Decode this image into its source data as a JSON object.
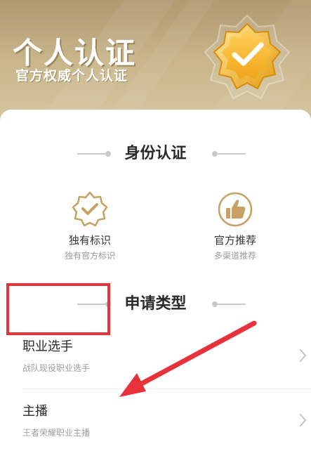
{
  "banner": {
    "title": "个人认证",
    "subtitle": "官方权威个人认证",
    "badge_icon": "verified-badge-icon",
    "colors": {
      "gold": "#f5b72c",
      "gold_dark": "#e39a12",
      "background": "#c8b58b"
    }
  },
  "identity_section": {
    "title": "身份认证",
    "features": [
      {
        "icon": "badge-check-icon",
        "name": "独有标识",
        "desc": "独有官方标识"
      },
      {
        "icon": "thumbs-up-icon",
        "name": "官方推荐",
        "desc": "多渠道推荐"
      }
    ]
  },
  "apply_section": {
    "title": "申请类型",
    "items": [
      {
        "title": "职业选手",
        "desc": "战队现役职业选手"
      },
      {
        "title": "主播",
        "desc": "王者荣耀职业主播"
      }
    ]
  },
  "annotations": {
    "highlight_color": "#e8323a",
    "accent_color": "#c8a063"
  }
}
